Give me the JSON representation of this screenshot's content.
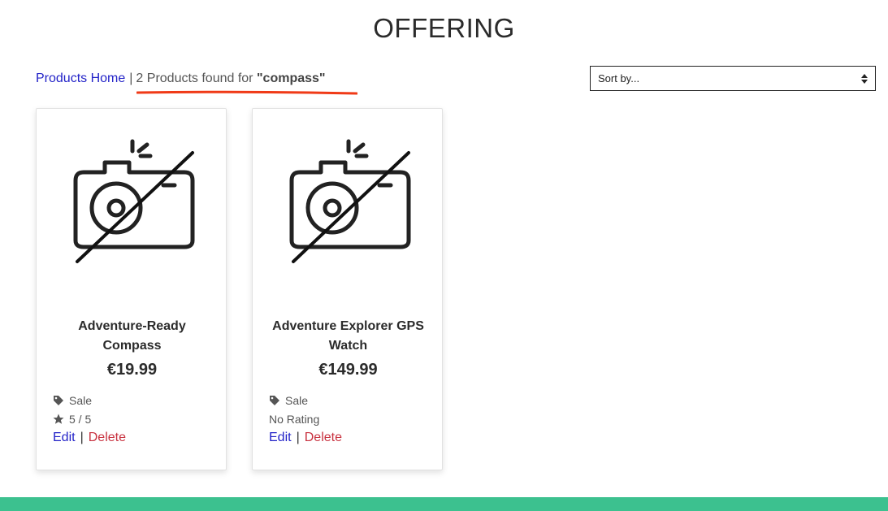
{
  "page": {
    "title": "OFFERING"
  },
  "breadcrumb": {
    "home_label": "Products Home",
    "separator": "|",
    "result_text": "2 Products found for",
    "query": "\"compass\""
  },
  "sort": {
    "selected": "Sort by..."
  },
  "products": [
    {
      "name": "Adventure-Ready Compass",
      "price": "€19.99",
      "tag": "Sale",
      "rating": "5 / 5",
      "edit_label": "Edit",
      "separator": "|",
      "delete_label": "Delete"
    },
    {
      "name": "Adventure Explorer GPS Watch",
      "price": "€149.99",
      "tag": "Sale",
      "rating": "No Rating",
      "edit_label": "Edit",
      "separator": "|",
      "delete_label": "Delete"
    }
  ],
  "colors": {
    "link": "#2323c8",
    "delete": "#c8313f",
    "annotation_underline": "#f03a17",
    "footer": "#3cc18f"
  },
  "icons": {
    "image_placeholder": "no-image-camera-icon",
    "tag": "tag-icon",
    "rating": "star-icon"
  }
}
